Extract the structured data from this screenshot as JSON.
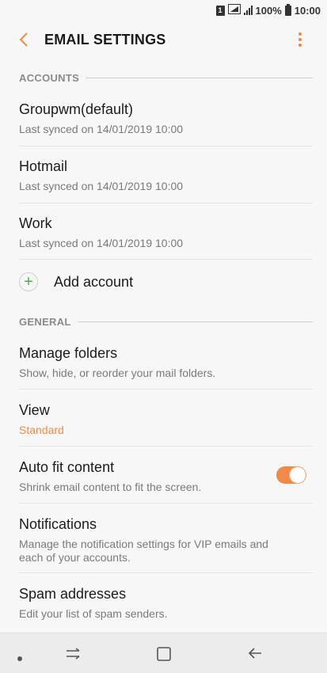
{
  "status_bar": {
    "sim_label": "1",
    "battery": "100%",
    "time": "10:00"
  },
  "header": {
    "title": "EMAIL SETTINGS"
  },
  "accounts_section": {
    "header": "ACCOUNTS",
    "items": [
      {
        "name": "Groupwm(default)",
        "sub": "Last synced on 14/01/2019  10:00"
      },
      {
        "name": "Hotmail",
        "sub": "Last synced on 14/01/2019  10:00"
      },
      {
        "name": "Work",
        "sub": "Last synced on 14/01/2019  10:00"
      }
    ],
    "add_account_label": "Add account"
  },
  "general_section": {
    "header": "GENERAL",
    "items": [
      {
        "title": "Manage folders",
        "sub": "Show, hide, or reorder your mail folders."
      },
      {
        "title": "View",
        "sub": "Standard"
      },
      {
        "title": "Auto fit content",
        "sub": "Shrink email content to fit the screen.",
        "toggle_on": true
      },
      {
        "title": "Notifications",
        "sub": "Manage the notification settings for VIP emails and each of your accounts."
      },
      {
        "title": "Spam addresses",
        "sub": "Edit your list of spam senders."
      }
    ]
  },
  "colors": {
    "accent": "#f08a46",
    "add_green": "#4cb24f",
    "background": "#f7f7f7"
  },
  "icons": {
    "back": "back-arrow-icon",
    "more": "more-vert-icon",
    "add": "plus-icon",
    "nav_dot": "nav-dot-icon",
    "nav_recents": "recents-icon",
    "nav_home": "home-icon",
    "nav_back": "nav-back-icon"
  }
}
